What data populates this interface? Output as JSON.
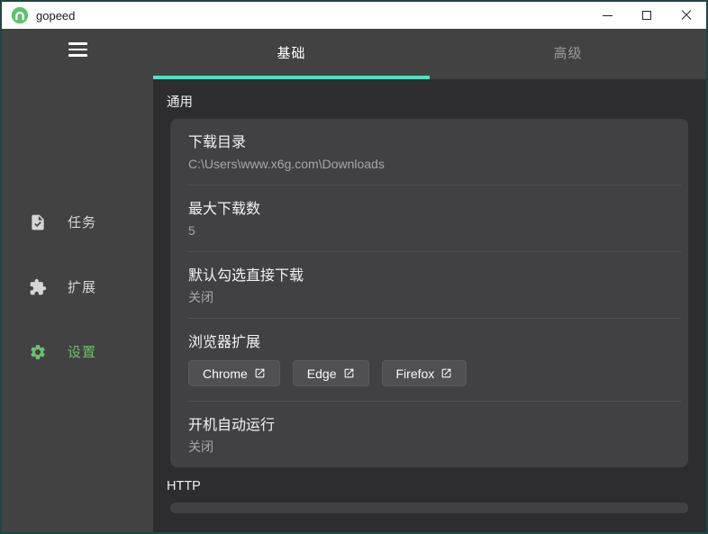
{
  "window": {
    "title": "gopeed"
  },
  "titlebar_icons": {
    "logo": "gopeed-logo (green circle with white arch)",
    "minimize": "minimize-line",
    "maximize": "maximize-square",
    "close": "close-x"
  },
  "sidebar": {
    "menu_icon": "hamburger-menu",
    "items": [
      {
        "label": "任务",
        "icon": "task-file-icon",
        "active": false
      },
      {
        "label": "扩展",
        "icon": "puzzle-icon",
        "active": false
      },
      {
        "label": "设置",
        "icon": "gear-icon",
        "active": true
      }
    ]
  },
  "tabs": [
    {
      "label": "基础",
      "active": true
    },
    {
      "label": "高级",
      "active": false
    }
  ],
  "sections": [
    {
      "label": "通用",
      "items": [
        {
          "title": "下载目录",
          "value": "C:\\Users\\www.x6g.com\\Downloads"
        },
        {
          "title": "最大下载数",
          "value": "5"
        },
        {
          "title": "默认勾选直接下载",
          "value": "关闭"
        },
        {
          "title": "浏览器扩展",
          "buttons": [
            "Chrome",
            "Edge",
            "Firefox"
          ],
          "button_icon": "open-in-new-icon"
        },
        {
          "title": "开机自动运行",
          "value": "关闭"
        }
      ]
    },
    {
      "label": "HTTP"
    }
  ],
  "colors": {
    "accent_teal": "#4BE1C3",
    "accent_green": "#6CBE6E",
    "frame_border": "#1D4743",
    "sidebar_bg": "#424242",
    "content_bg": "#2D2D2F",
    "card_bg": "#414144",
    "titlebar_bg": "#FFFFFF"
  }
}
